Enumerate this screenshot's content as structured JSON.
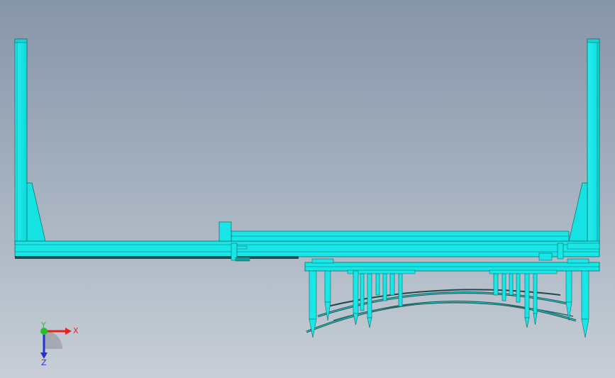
{
  "viewport": {
    "background_top": "#8795a9",
    "background_bottom": "#c7ced6"
  },
  "model": {
    "body_color": "#19e6e6",
    "edge_color": "#0a6a6a",
    "shadow_color": "#1f4a4a"
  },
  "triad": {
    "x_label": "X",
    "y_label": "Y",
    "z_label": "Z",
    "x_color": "#e8211f",
    "y_color": "#25c125",
    "z_color": "#2532d8"
  }
}
